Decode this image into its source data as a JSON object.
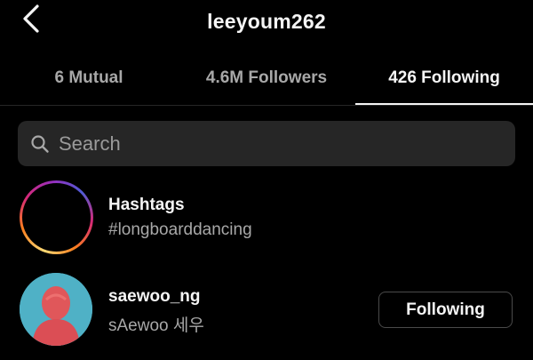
{
  "header": {
    "title": "leeyoum262",
    "back_icon": "chevron-left-icon"
  },
  "tabs": [
    {
      "label": "6 Mutual",
      "active": false
    },
    {
      "label": "4.6M Followers",
      "active": false
    },
    {
      "label": "426 Following",
      "active": true
    }
  ],
  "search": {
    "placeholder": "Search",
    "value": "",
    "icon": "search-icon"
  },
  "list": [
    {
      "type": "hashtags",
      "title": "Hashtags",
      "subtitle": "#longboarddancing",
      "icon": "hashtag-icon"
    },
    {
      "type": "user",
      "title": "saewoo_ng",
      "subtitle": "sAewoo 세우",
      "button_label": "Following"
    }
  ],
  "colors": {
    "background": "#000000",
    "text_primary": "#f5f5f5",
    "text_secondary": "#a8a8a8",
    "search_bg": "#262626",
    "button_border": "#4a4a4a"
  }
}
